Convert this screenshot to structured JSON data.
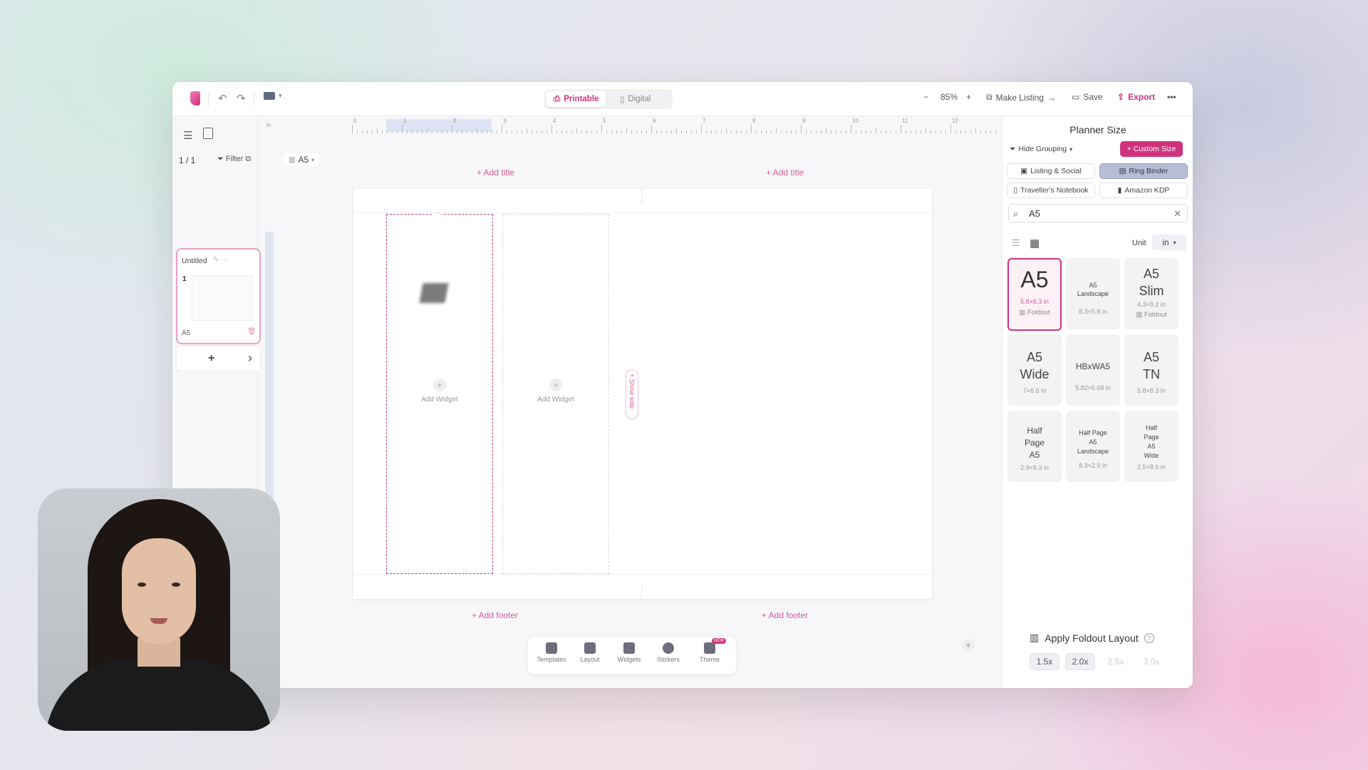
{
  "toolbar": {
    "mode_printable": "Printable",
    "mode_digital": "Digital",
    "zoom": "85%",
    "make_listing": "Make Listing",
    "save": "Save",
    "export": "Export"
  },
  "pages_panel": {
    "page_count": "1 / 1",
    "filter": "Filter",
    "page_name": "Untitled",
    "page_number": "1",
    "page_size": "A5",
    "add": "+",
    "next": "›"
  },
  "canvas": {
    "size_selector": "A5",
    "ruler_marks": [
      "0",
      "1",
      "2",
      "3",
      "4",
      "5",
      "6",
      "7",
      "8",
      "9",
      "10",
      "11",
      "12"
    ],
    "add_title": "+ Add title",
    "add_footer": "+ Add footer",
    "add_widget": "Add Widget",
    "show_side": "+ Show side",
    "zoom_add": "+"
  },
  "bottom_tools": [
    {
      "label": "Templates"
    },
    {
      "label": "Layout"
    },
    {
      "label": "Widgets"
    },
    {
      "label": "Stickers"
    },
    {
      "label": "Theme",
      "badge": "NEW"
    }
  ],
  "right_panel": {
    "title": "Planner Size",
    "hide_grouping": "Hide Grouping",
    "custom_size": "+ Custom Size",
    "categories": [
      {
        "label": "Listing & Social",
        "active": false
      },
      {
        "label": "Ring Binder",
        "active": true
      },
      {
        "label": "Traveller's Notebook",
        "active": false
      },
      {
        "label": "Amazon KDP",
        "active": false
      }
    ],
    "search_value": "A5",
    "unit_label": "Unit",
    "unit_value": "in",
    "sizes": [
      {
        "name": "A5",
        "dims": "5.8×8.3 in",
        "tag": "Foldout",
        "selected": true
      },
      {
        "name": "A5 Landscape",
        "dims": "8.3×5.8 in"
      },
      {
        "name": "A5 Slim",
        "dims": "4.3×8.2 in",
        "tag": "Foldout"
      },
      {
        "name": "A5 Wide",
        "dims": "7×8.6 in"
      },
      {
        "name": "HBxWA5",
        "dims": "5.82×6.68 in"
      },
      {
        "name": "A5 TN",
        "dims": "5.8×8.3 in"
      },
      {
        "name": "Half Page A5",
        "dims": "2.9×8.3 in"
      },
      {
        "name": "Half Page A5 Landscape",
        "dims": "8.3×2.9 in"
      },
      {
        "name": "Half Page A5 Wide",
        "dims": "2.5×8.6 in"
      }
    ],
    "apply_foldout": "Apply Foldout Layout",
    "foldout_options": [
      {
        "label": "1.5x",
        "enabled": true
      },
      {
        "label": "2.0x",
        "enabled": true
      },
      {
        "label": "2.5x",
        "enabled": false
      },
      {
        "label": "3.0x",
        "enabled": false
      }
    ]
  }
}
